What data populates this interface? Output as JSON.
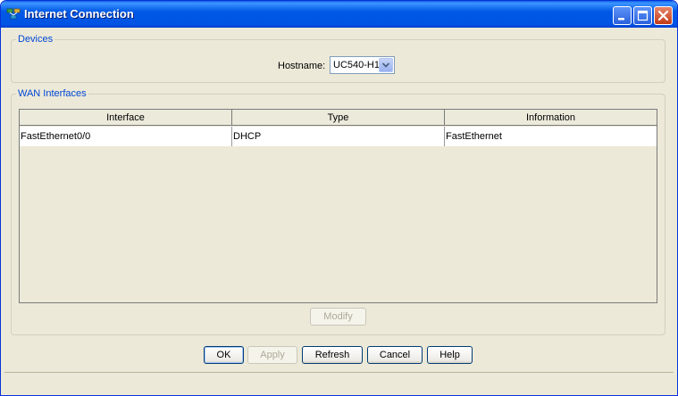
{
  "window": {
    "title": "Internet Connection",
    "icon": "network-app-icon"
  },
  "devices": {
    "legend": "Devices",
    "hostname_label": "Hostname:",
    "hostname_value": "UC540-H1"
  },
  "wan": {
    "legend": "WAN Interfaces",
    "columns": [
      "Interface",
      "Type",
      "Information"
    ],
    "rows": [
      {
        "interface": "FastEthernet0/0",
        "type": "DHCP",
        "information": "FastEthernet"
      }
    ],
    "modify_label": "Modify"
  },
  "buttons": {
    "ok": "OK",
    "apply": "Apply",
    "refresh": "Refresh",
    "cancel": "Cancel",
    "help": "Help"
  },
  "colors": {
    "titlebar": "#0054e3",
    "legend_text": "#0046d5",
    "dialog_bg": "#ece9d8",
    "close_button": "#c23b17"
  }
}
